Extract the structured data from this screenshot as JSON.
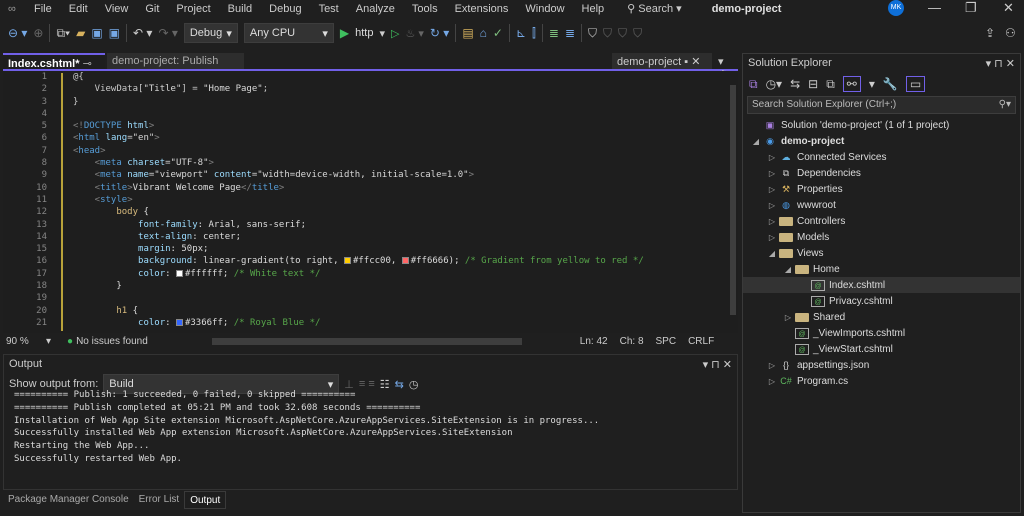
{
  "menu": [
    "File",
    "Edit",
    "View",
    "Git",
    "Project",
    "Build",
    "Debug",
    "Test",
    "Analyze",
    "Tools",
    "Extensions",
    "Window",
    "Help"
  ],
  "search_label": "Search",
  "window_title": "demo-project",
  "user_initials": "MK",
  "toolbar": {
    "config": "Debug",
    "platform": "Any CPU",
    "run_target": "http"
  },
  "tabs": {
    "active": "Index.cshtml*",
    "second": "demo-project: Publish",
    "right": "demo-project"
  },
  "code": [
    [
      [
        "@{",
        "t-raz"
      ]
    ],
    [
      [
        "    ViewData[",
        "t-raz"
      ],
      [
        "\"Title\"",
        "t-str"
      ],
      [
        "] = ",
        "t-raz"
      ],
      [
        "\"Home Page\"",
        "t-str"
      ],
      [
        ";",
        "t-raz"
      ]
    ],
    [
      [
        "}",
        "t-raz"
      ]
    ],
    [],
    [
      [
        "<!",
        "t-tag"
      ],
      [
        "DOCTYPE",
        "t-name"
      ],
      [
        " html",
        "t-attr"
      ],
      [
        ">",
        "t-tag"
      ]
    ],
    [
      [
        "<",
        "t-tag"
      ],
      [
        "html",
        "t-name"
      ],
      [
        " lang",
        "t-attr"
      ],
      [
        "=\"en\"",
        "t-str"
      ],
      [
        ">",
        "t-tag"
      ]
    ],
    [
      [
        "<",
        "t-tag"
      ],
      [
        "head",
        "t-name"
      ],
      [
        ">",
        "t-tag"
      ]
    ],
    [
      [
        "    <",
        "t-tag"
      ],
      [
        "meta",
        "t-name"
      ],
      [
        " charset",
        "t-attr"
      ],
      [
        "=\"UTF-8\"",
        "t-str"
      ],
      [
        ">",
        "t-tag"
      ]
    ],
    [
      [
        "    <",
        "t-tag"
      ],
      [
        "meta",
        "t-name"
      ],
      [
        " name",
        "t-attr"
      ],
      [
        "=\"viewport\"",
        "t-str"
      ],
      [
        " content",
        "t-attr"
      ],
      [
        "=\"width=device-width, initial-scale=1.0\"",
        "t-str"
      ],
      [
        ">",
        "t-tag"
      ]
    ],
    [
      [
        "    <",
        "t-tag"
      ],
      [
        "title",
        "t-name"
      ],
      [
        ">",
        "t-tag"
      ],
      [
        "Vibrant Welcome Page",
        ""
      ],
      [
        "</",
        "t-tag"
      ],
      [
        "title",
        "t-name"
      ],
      [
        ">",
        "t-tag"
      ]
    ],
    [
      [
        "    <",
        "t-tag"
      ],
      [
        "style",
        "t-name"
      ],
      [
        ">",
        "t-tag"
      ]
    ],
    [
      [
        "        body",
        "t-sel"
      ],
      [
        " {",
        ""
      ]
    ],
    [
      [
        "            font-family",
        "t-prop"
      ],
      [
        ": Arial, sans-serif;",
        ""
      ]
    ],
    [
      [
        "            text-align",
        "t-prop"
      ],
      [
        ": center;",
        ""
      ]
    ],
    [
      [
        "            margin",
        "t-prop"
      ],
      [
        ": 50px;",
        ""
      ]
    ],
    [
      [
        "            background",
        "t-prop"
      ],
      [
        ": linear-gradient(to right, ",
        ""
      ],
      [
        "#ffcc00",
        "sw"
      ],
      [
        ", ",
        ""
      ],
      [
        "#ff6666",
        "sw"
      ],
      [
        "); ",
        ""
      ],
      [
        "/* Gradient from yellow to red */",
        "t-cmt"
      ]
    ],
    [
      [
        "            color",
        "t-prop"
      ],
      [
        ": ",
        ""
      ],
      [
        "#ffffff",
        "sw"
      ],
      [
        "; ",
        ""
      ],
      [
        "/* White text */",
        "t-cmt"
      ]
    ],
    [
      [
        "        }",
        ""
      ]
    ],
    [],
    [
      [
        "        h1",
        "t-sel"
      ],
      [
        " {",
        ""
      ]
    ],
    [
      [
        "            color",
        "t-prop"
      ],
      [
        ": ",
        ""
      ],
      [
        "#3366ff",
        "sw"
      ],
      [
        "; ",
        ""
      ],
      [
        "/* Royal Blue */",
        "t-cmt"
      ]
    ]
  ],
  "status": {
    "zoom": "90 %",
    "issues": "No issues found",
    "line": "Ln: 42",
    "char": "Ch: 8",
    "spaces": "SPC",
    "eol": "CRLF"
  },
  "output": {
    "title": "Output",
    "show_from_label": "Show output from:",
    "source": "Build",
    "lines": [
      "========== Publish: 1 succeeded, 0 failed, 0 skipped ==========",
      "========== Publish completed at 05:21 PM and took 32.608 seconds ==========",
      "Installation of Web App Site extension Microsoft.AspNetCore.AzureAppServices.SiteExtension is in progress...",
      "Successfully installed Web App extension Microsoft.AspNetCore.AzureAppServices.SiteExtension",
      "Restarting the Web App...",
      "Successfully restarted Web App."
    ]
  },
  "bottom_tabs": [
    "Package Manager Console",
    "Error List",
    "Output"
  ],
  "solution_explorer": {
    "title": "Solution Explorer",
    "search_placeholder": "Search Solution Explorer (Ctrl+;)",
    "nodes": [
      {
        "label": "Solution 'demo-project' (1 of 1 project)",
        "level": 0,
        "arrow": "",
        "icon": "solution-icon"
      },
      {
        "label": "demo-project",
        "level": 0,
        "arrow": "open",
        "icon": "project-icon",
        "bold": true
      },
      {
        "label": "Connected Services",
        "level": 1,
        "arrow": "closed",
        "icon": "cloud-icon"
      },
      {
        "label": "Dependencies",
        "level": 1,
        "arrow": "closed",
        "icon": "dependencies-icon"
      },
      {
        "label": "Properties",
        "level": 1,
        "arrow": "closed",
        "icon": "properties-icon"
      },
      {
        "label": "wwwroot",
        "level": 1,
        "arrow": "closed",
        "icon": "globe-icon"
      },
      {
        "label": "Controllers",
        "level": 1,
        "arrow": "closed",
        "icon": "folder-icon"
      },
      {
        "label": "Models",
        "level": 1,
        "arrow": "closed",
        "icon": "folder-icon"
      },
      {
        "label": "Views",
        "level": 1,
        "arrow": "open",
        "icon": "folder-icon"
      },
      {
        "label": "Home",
        "level": 2,
        "arrow": "open",
        "icon": "folder-icon"
      },
      {
        "label": "Index.cshtml",
        "level": 3,
        "arrow": "",
        "icon": "razor-file-icon",
        "selected": true
      },
      {
        "label": "Privacy.cshtml",
        "level": 3,
        "arrow": "",
        "icon": "razor-file-icon"
      },
      {
        "label": "Shared",
        "level": 2,
        "arrow": "closed",
        "icon": "folder-icon"
      },
      {
        "label": "_ViewImports.cshtml",
        "level": 2,
        "arrow": "",
        "icon": "razor-file-icon"
      },
      {
        "label": "_ViewStart.cshtml",
        "level": 2,
        "arrow": "",
        "icon": "razor-file-icon"
      },
      {
        "label": "appsettings.json",
        "level": 1,
        "arrow": "closed",
        "icon": "json-file-icon"
      },
      {
        "label": "Program.cs",
        "level": 1,
        "arrow": "closed",
        "icon": "csharp-file-icon"
      }
    ]
  },
  "colors": {
    "accent": "#7160e8",
    "background": "#1f1f1f",
    "editor": "#1e1e1e",
    "avatar": "#0e6fd8"
  }
}
